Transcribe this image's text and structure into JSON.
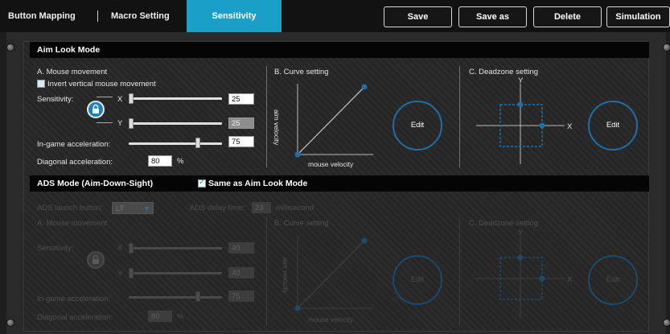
{
  "tabs": {
    "button_mapping": "Button Mapping",
    "macro_setting": "Macro Setting",
    "sensitivity": "Sensitivity"
  },
  "toolbar": {
    "save": "Save",
    "save_as": "Save as",
    "delete": "Delete",
    "simulation": "Simulation"
  },
  "aim": {
    "header": "Aim Look Mode",
    "mouse_movement": "A. Mouse movement",
    "invert_label": "Invert vertical mouse movement",
    "sensitivity_label": "Sensitivity:",
    "x_label": "X",
    "y_label": "Y",
    "x_value": "25",
    "y_value": "25",
    "ingame_label": "In-game acceleration:",
    "ingame_value": "75",
    "diagonal_label": "Diagonal acceleration:",
    "diagonal_value": "80",
    "percent": "%",
    "curve_title": "B. Curve setting",
    "curve_y_label": "aim velocity",
    "curve_x_label": "mouse velocity",
    "edit": "Edit",
    "deadzone_title": "C. Deadzone setting",
    "dz_y": "Y",
    "dz_x": "X"
  },
  "ads": {
    "header": "ADS Mode (Aim-Down-Sight)",
    "same_as": "Same as Aim Look Mode",
    "launch_label": "ADS launch button:",
    "launch_value": "LT",
    "delay_label": "ADS delay time:",
    "delay_value": "23",
    "delay_unit": "millisecond",
    "mouse_movement": "A. Mouse movement",
    "sensitivity_label": "Sensitivity:",
    "x_label": "X",
    "y_label": "Y",
    "x_value": "40",
    "y_value": "40",
    "ingame_label": "In-game acceleration:",
    "ingame_value": "75",
    "diagonal_label": "Diagonal acceleration:",
    "diagonal_value": "80",
    "percent": "%",
    "curve_title": "B. Curve setting",
    "curve_y_label": "aim velocity",
    "curve_x_label": "mouse velocity",
    "edit": "Edit",
    "deadzone_title": "C. Deadzone setting",
    "dz_y": "Y",
    "dz_x": "X"
  },
  "state": {
    "aim_x_slider": 0,
    "aim_y_slider": 0,
    "aim_ingame_slider": 0.75,
    "ads_x_slider": 0,
    "ads_y_slider": 0,
    "ads_ingame_slider": 0.75,
    "invert_checked": false,
    "same_as_checked": true
  },
  "colors": {
    "accent": "#1aa0c8",
    "curve": "#1e6fa8"
  }
}
